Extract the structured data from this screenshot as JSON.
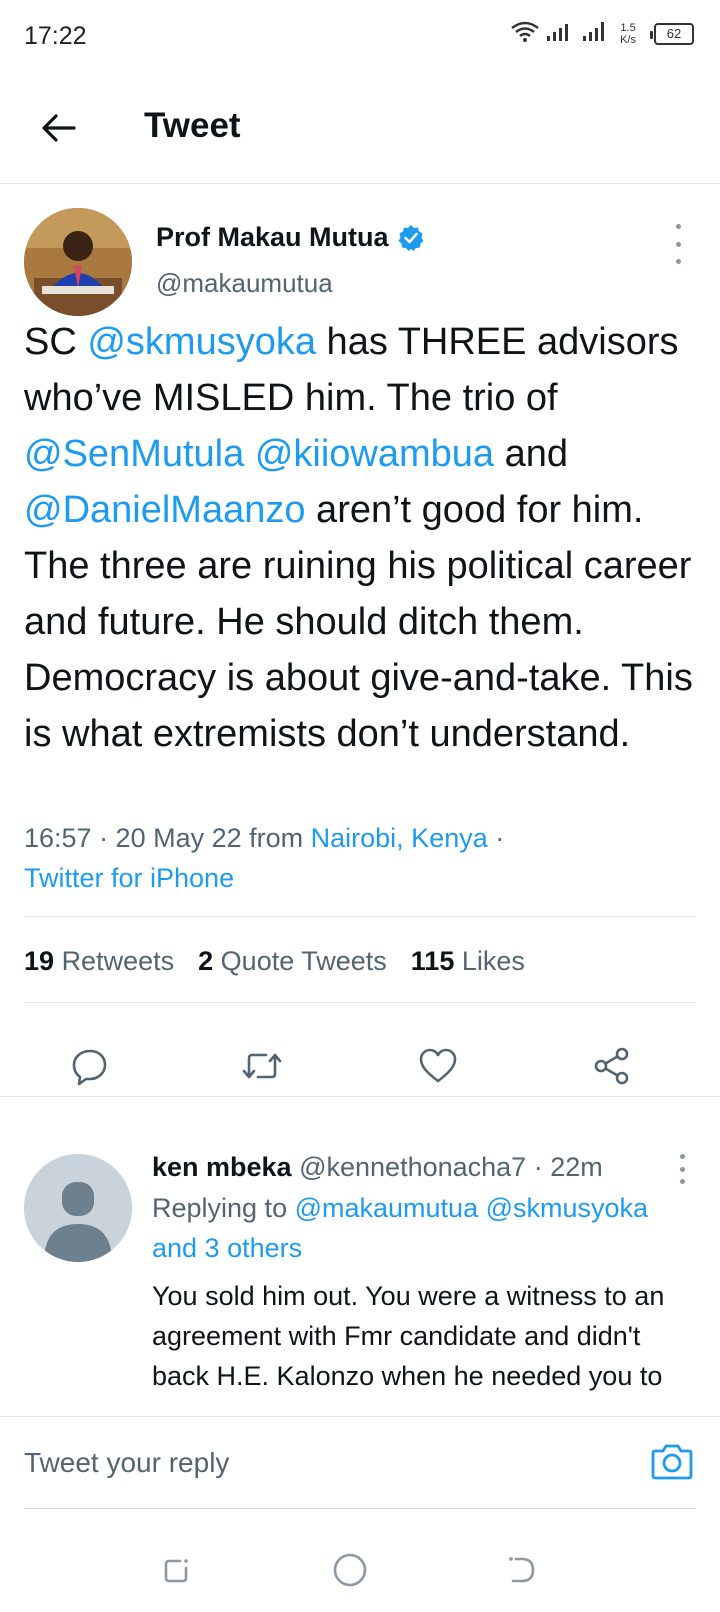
{
  "status_bar": {
    "time": "17:22",
    "net_speed_value": "1.5",
    "net_speed_unit": "K/s",
    "battery": "62"
  },
  "header": {
    "title": "Tweet"
  },
  "tweet": {
    "author_name": "Prof Makau Mutua",
    "author_handle": "@makaumutua",
    "text_parts": [
      {
        "text": "SC ",
        "type": "text"
      },
      {
        "text": "@skmusyoka",
        "type": "mention"
      },
      {
        "text": " has THREE advisors who’ve MISLED him. The trio of ",
        "type": "text"
      },
      {
        "text": "@SenMutula",
        "type": "mention"
      },
      {
        "text": " ",
        "type": "text"
      },
      {
        "text": "@kiiowambua",
        "type": "mention"
      },
      {
        "text": " and ",
        "type": "text"
      },
      {
        "text": "@DanielMaanzo",
        "type": "mention"
      },
      {
        "text": " aren’t good for him. The three are ruining his political career and future. He should ditch them. Democracy is about give-and-take. This is what extremists don’t understand.",
        "type": "text"
      }
    ],
    "meta_time": "16:57 · 20 May 22 from ",
    "meta_location": "Nairobi, Kenya",
    "meta_sep": " ·",
    "meta_client": "Twitter for iPhone",
    "stats": {
      "retweets_count": "19",
      "retweets_label": "Retweets",
      "quotes_count": "2",
      "quotes_label": "Quote Tweets",
      "likes_count": "115",
      "likes_label": "Likes"
    },
    "action_icons": [
      "reply-icon",
      "retweet-icon",
      "like-icon",
      "share-icon"
    ]
  },
  "reply": {
    "author_name": "ken mbeka",
    "author_handle": "@kennethonacha7",
    "time": "22m",
    "replying_prefix": "Replying to ",
    "replying_mentions": "@makaumutua @skmusyoka",
    "replying_others": "and 3 others",
    "text": "You sold him out. You were a witness to an agreement with Fmr candidate and didn't back  H.E. Kalonzo when he needed you to"
  },
  "reply_bar": {
    "placeholder": "Tweet your reply"
  },
  "colors": {
    "accent": "#1d9bf0",
    "secondary_text": "#536471",
    "primary_text": "#0f1419",
    "verified": "#1d9bf0"
  }
}
